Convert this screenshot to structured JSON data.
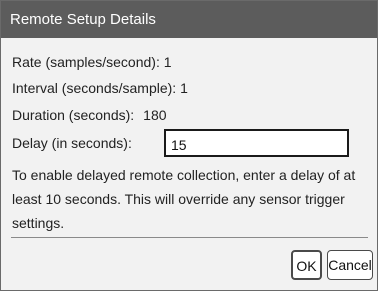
{
  "dialog": {
    "title": "Remote Setup Details",
    "rate_label": "Rate (samples/second): 1",
    "interval_label": "Interval (seconds/sample): 1",
    "duration_label": "Duration (seconds):",
    "duration_value": "180",
    "delay_label": "Delay (in seconds):",
    "delay_value": "15",
    "description": "To enable delayed remote collection, enter a delay of at least 10 seconds.  This will override any sensor trigger settings.",
    "ok_label": "OK",
    "cancel_label": "Cancel"
  },
  "colors": {
    "titlebar": "#5c5c5c",
    "background": "#f2f2f2"
  }
}
